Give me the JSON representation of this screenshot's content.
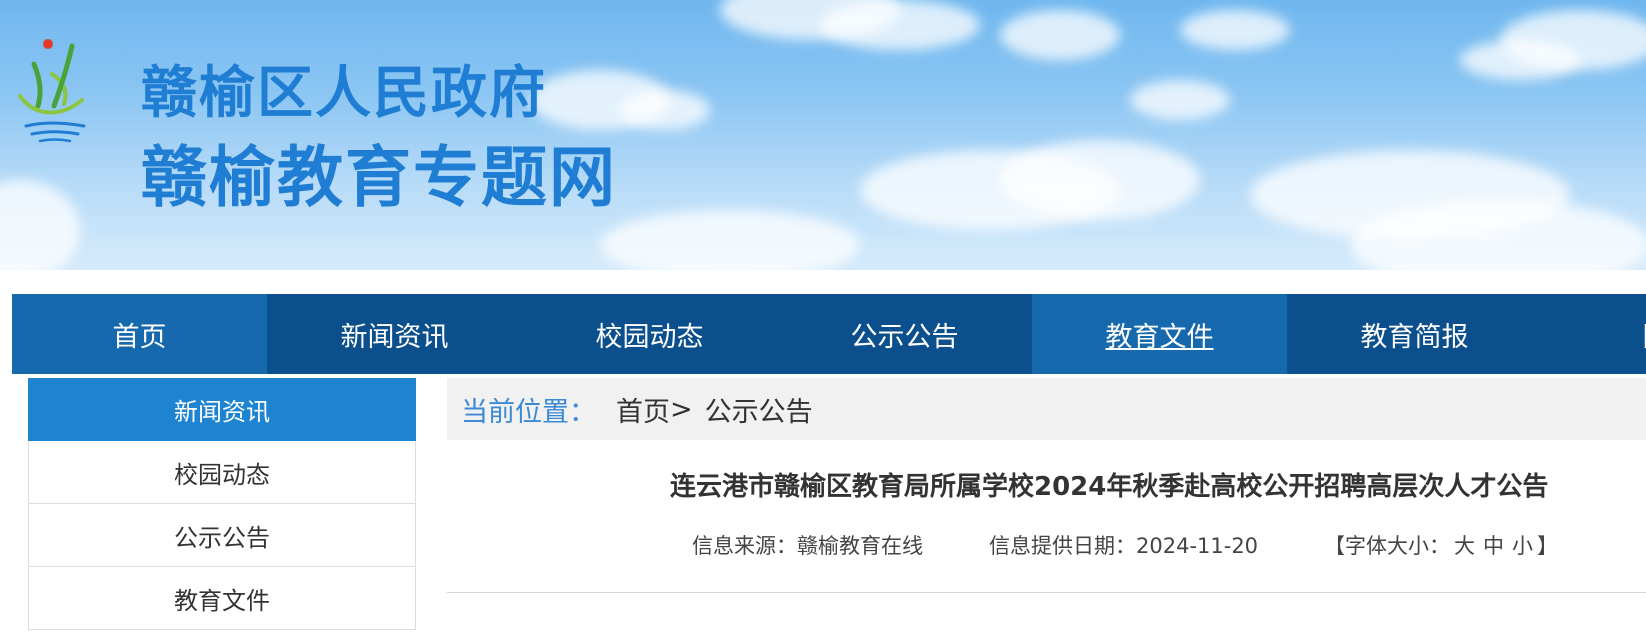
{
  "site": {
    "title_line1": "赣榆区人民政府",
    "title_line2": "赣榆教育专题网"
  },
  "nav": {
    "items": [
      {
        "label": "首页"
      },
      {
        "label": "新闻资讯"
      },
      {
        "label": "校园动态"
      },
      {
        "label": "公示公告"
      },
      {
        "label": "教育文件"
      },
      {
        "label": "教育简报"
      },
      {
        "label": "图片"
      }
    ]
  },
  "sidebar": {
    "items": [
      {
        "label": "新闻资讯"
      },
      {
        "label": "校园动态"
      },
      {
        "label": "公示公告"
      },
      {
        "label": "教育文件"
      }
    ]
  },
  "breadcrumb": {
    "label": "当前位置：",
    "home": "首页",
    "separator": ">",
    "current": "公示公告"
  },
  "article": {
    "title": "连云港市赣榆区教育局所属学校2024年秋季赴高校公开招聘高层次人才公告",
    "source_label": "信息来源：",
    "source": "赣榆教育在线",
    "date_label": "信息提供日期：",
    "date": "2024-11-20",
    "fontsize_open": "【字体大小：",
    "fontsize_large": "大",
    "fontsize_medium": "中",
    "fontsize_small": "小",
    "fontsize_close": "】"
  },
  "colors": {
    "nav_bg": "#0b4f8c",
    "nav_active": "#1769ad",
    "sidebar_active": "#1e84d2",
    "title_blue": "#1f7ed3"
  }
}
